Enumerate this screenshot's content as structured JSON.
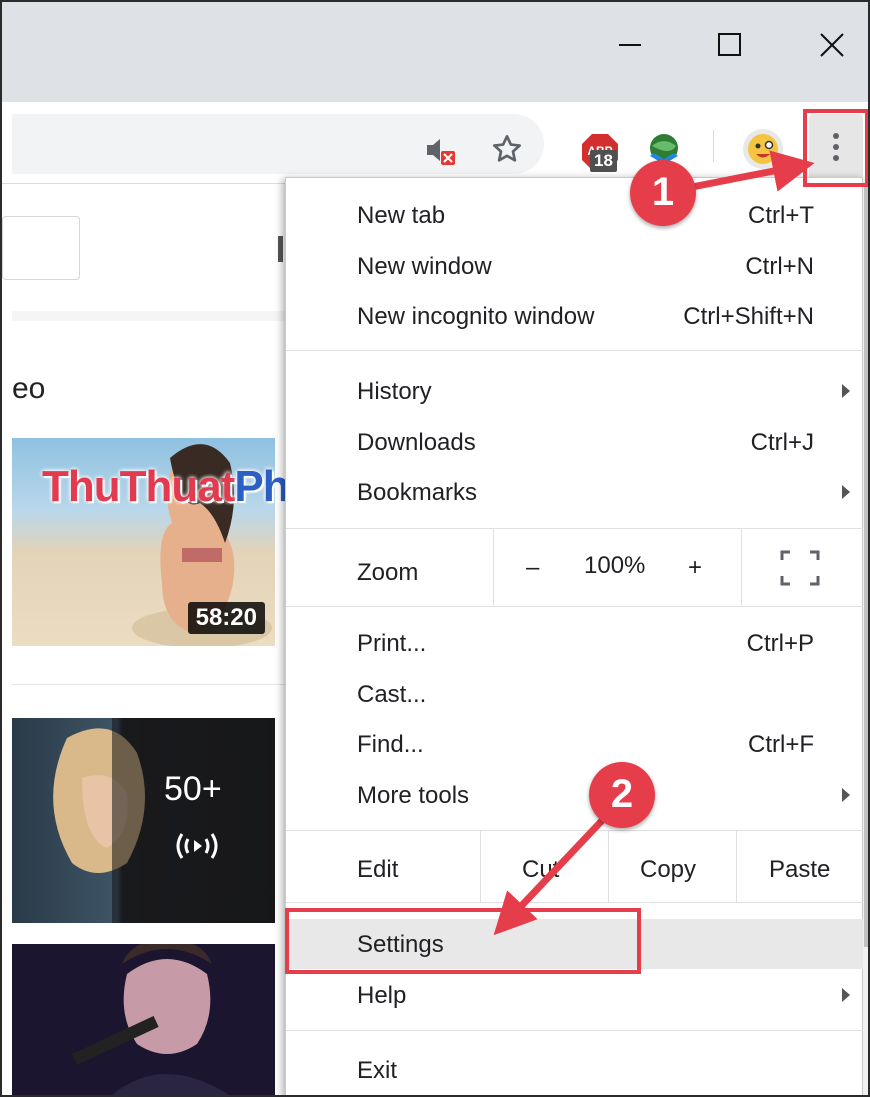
{
  "toolbar": {
    "abp_badge_count": "18"
  },
  "page": {
    "heading_fragment": "eo",
    "video1_duration": "58:20",
    "video2_count": "50+"
  },
  "watermark": {
    "part_a": "ThuThuat",
    "part_b": "PhanMem.vn",
    "overlap_text": "Bookmarks"
  },
  "menu": {
    "new_tab": {
      "label": "New tab",
      "shortcut": "Ctrl+T"
    },
    "new_window": {
      "label": "New window",
      "shortcut": "Ctrl+N"
    },
    "new_incognito": {
      "label": "New incognito window",
      "shortcut": "Ctrl+Shift+N"
    },
    "history": {
      "label": "History"
    },
    "downloads": {
      "label": "Downloads",
      "shortcut": "Ctrl+J"
    },
    "bookmarks": {
      "label": "Bookmarks"
    },
    "zoom": {
      "label": "Zoom",
      "minus": "–",
      "value": "100%",
      "plus": "+"
    },
    "print": {
      "label": "Print...",
      "shortcut": "Ctrl+P"
    },
    "cast": {
      "label": "Cast..."
    },
    "find": {
      "label": "Find...",
      "shortcut": "Ctrl+F"
    },
    "more_tools": {
      "label": "More tools"
    },
    "edit": {
      "label": "Edit",
      "cut": "Cut",
      "copy": "Copy",
      "paste": "Paste"
    },
    "settings": {
      "label": "Settings"
    },
    "help": {
      "label": "Help"
    },
    "exit": {
      "label": "Exit"
    }
  },
  "annotations": {
    "step1": "1",
    "step2": "2",
    "color": "#e53e4a"
  }
}
